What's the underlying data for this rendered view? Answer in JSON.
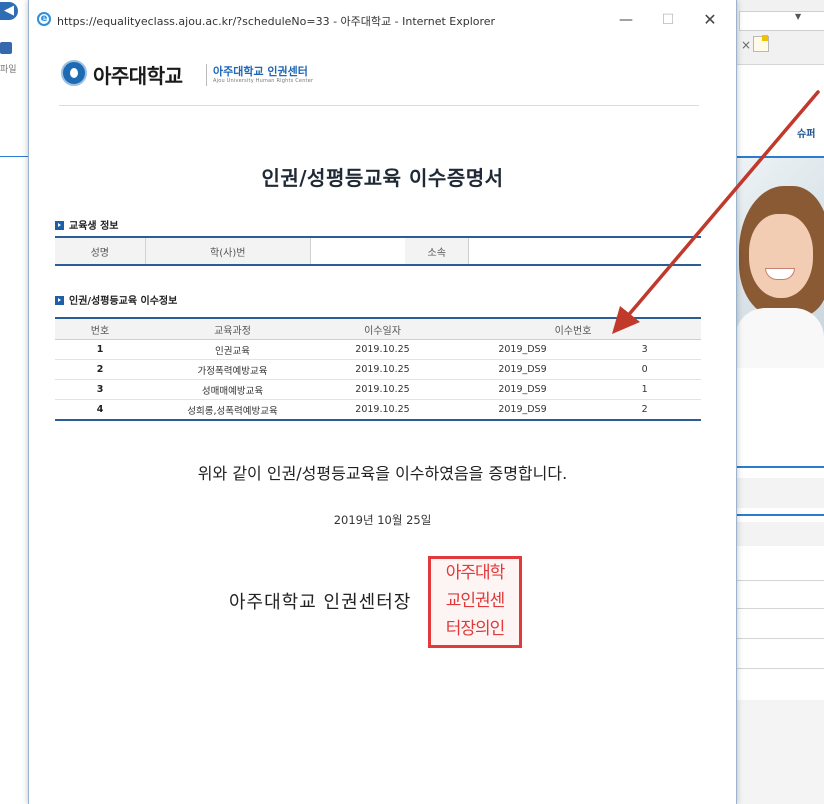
{
  "background_browser": {
    "back_icon": "arrow-left-icon",
    "side_file_label": "파일",
    "nav_text": "슈퍼",
    "tab_close": "×"
  },
  "popup": {
    "url_title": "https://equalityeclass.ajou.ac.kr/?scheduleNo=33 - 아주대학교 - Internet Explorer",
    "window_buttons": {
      "minimize": "—",
      "maximize": "☐",
      "close": "✕"
    }
  },
  "header": {
    "logo_name": "아주대학교",
    "logo_sub": "아주대학교 인권센터",
    "logo_sub_en": "Ajou University Human Rights Center"
  },
  "certificate": {
    "title": "인권/성평등교육 이수증명서",
    "section_student": "교육생 정보",
    "student_fields": {
      "name_label": "성명",
      "id_label": "학(사)번",
      "dept_label": "소속"
    },
    "section_completion": "인권/성평등교육 이수정보",
    "columns": [
      "번호",
      "교육과정",
      "이수일자",
      "이수번호"
    ],
    "rows": [
      {
        "no": "1",
        "course": "인권교육",
        "date": "2019.10.25",
        "cert_no": "2019_DS9",
        "cert_tail": "3"
      },
      {
        "no": "2",
        "course": "가정폭력예방교육",
        "date": "2019.10.25",
        "cert_no": "2019_DS9",
        "cert_tail": "0"
      },
      {
        "no": "3",
        "course": "성매매예방교육",
        "date": "2019.10.25",
        "cert_no": "2019_DS9",
        "cert_tail": "1"
      },
      {
        "no": "4",
        "course": "성희롱,성폭력예방교육",
        "date": "2019.10.25",
        "cert_no": "2019_DS9",
        "cert_tail": "2"
      }
    ],
    "statement": "위와 같이 인권/성평등교육을 이수하였음을 증명합니다.",
    "issue_date": "2019년 10월 25일",
    "issuer": "아주대학교 인권센터장",
    "stamp_lines": [
      "아주대학",
      "교인권센",
      "터장의인"
    ]
  },
  "colors": {
    "accent_blue": "#2b5e96",
    "stamp_red": "#e23a3a",
    "arrow_red": "#c0392b"
  }
}
